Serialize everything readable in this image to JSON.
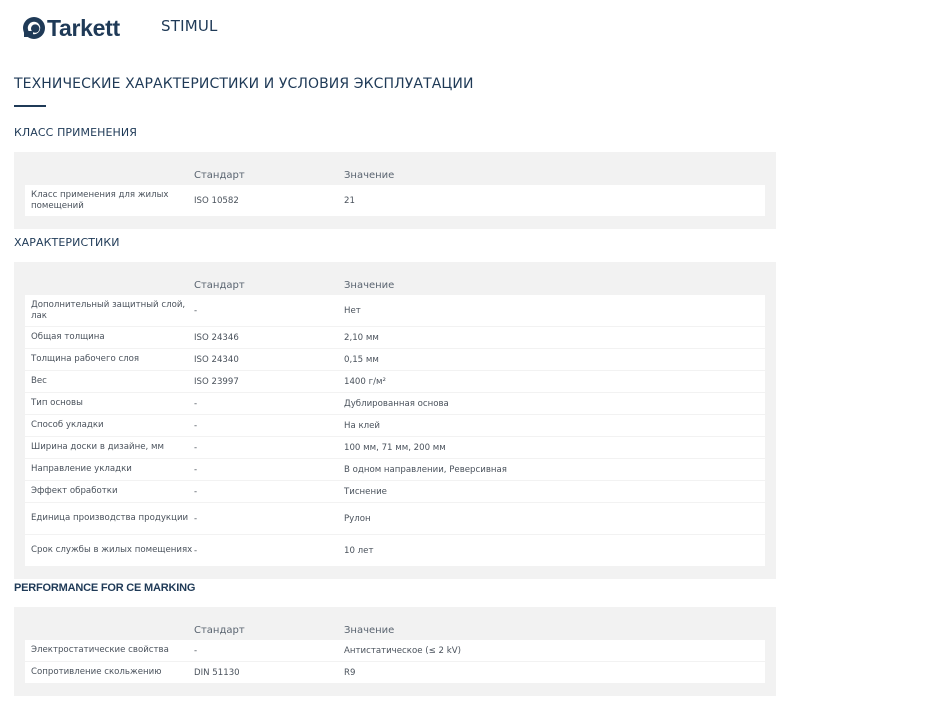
{
  "header": {
    "brand": "Tarkett",
    "product": "STIMUL"
  },
  "title": "ТЕХНИЧЕСКИЕ ХАРАКТЕРИСТИКИ И УСЛОВИЯ ЭКСПЛУАТАЦИИ",
  "columns": {
    "standard": "Стандарт",
    "value": "Значение"
  },
  "sections": [
    {
      "heading": "КЛАСС ПРИМЕНЕНИЯ",
      "rows": [
        {
          "name": "Класс применения для жилых помещений",
          "standard": "ISO 10582",
          "value": "21"
        }
      ]
    },
    {
      "heading": "ХАРАКТЕРИСТИКИ",
      "rows": [
        {
          "name": "Дополнительный защитный слой, лак",
          "standard": "-",
          "value": "Нет"
        },
        {
          "name": "Общая толщина",
          "standard": "ISO 24346",
          "value": "2,10 мм"
        },
        {
          "name": "Толщина рабочего слоя",
          "standard": "ISO 24340",
          "value": "0,15 мм"
        },
        {
          "name": "Вес",
          "standard": "ISO 23997",
          "value": "1400 г/м²"
        },
        {
          "name": "Тип основы",
          "standard": "-",
          "value": "Дублированная основа"
        },
        {
          "name": "Способ укладки",
          "standard": "-",
          "value": "На клей"
        },
        {
          "name": "Ширина доски в дизайне, мм",
          "standard": "-",
          "value": "100 мм, 71 мм, 200 мм"
        },
        {
          "name": "Направление укладки",
          "standard": "-",
          "value": "В одном направлении, Реверсивная"
        },
        {
          "name": "Эффект обработки",
          "standard": "-",
          "value": "Тиснение"
        },
        {
          "name": "Единица производства продукции",
          "standard": "-",
          "value": "Рулон"
        },
        {
          "name": "Срок службы в жилых помещениях",
          "standard": "-",
          "value": "10 лет"
        }
      ]
    },
    {
      "heading": "PERFORMANCE FOR CE MARKING",
      "rows": [
        {
          "name": "Электростатические свойства",
          "standard": "-",
          "value": "Антистатическое (≤ 2 kV)"
        },
        {
          "name": "Сопротивление скольжению",
          "standard": "DIN 51130",
          "value": "R9"
        }
      ]
    }
  ]
}
